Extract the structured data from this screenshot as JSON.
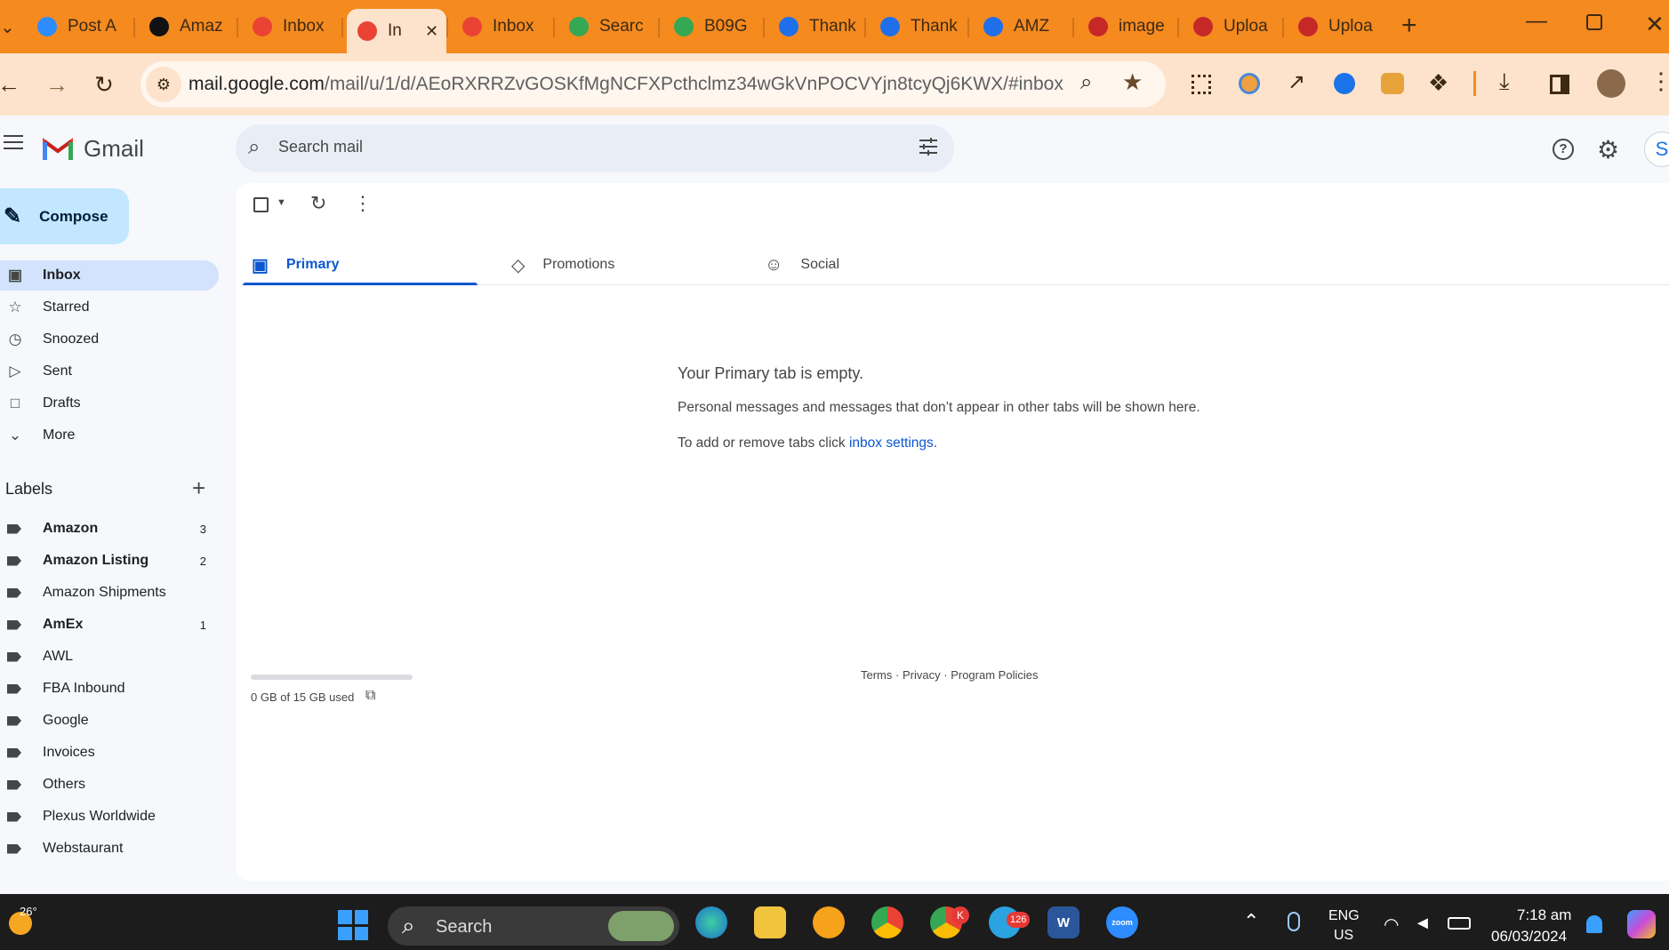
{
  "browser": {
    "tabs": [
      {
        "title": "Post A",
        "icon": "zoom-icon",
        "color": "#2d8cff"
      },
      {
        "title": "Amaz",
        "icon": "amazon-icon",
        "color": "#111111"
      },
      {
        "title": "Inbox",
        "icon": "gmail-icon",
        "color": "#ea4335"
      },
      {
        "title": "In",
        "icon": "gmail-icon",
        "color": "#ea4335",
        "active": true
      },
      {
        "title": "Inbox",
        "icon": "gmail-icon",
        "color": "#ea4335"
      },
      {
        "title": "Searc",
        "icon": "drive-icon",
        "color": "#34a853"
      },
      {
        "title": "B09G",
        "icon": "drive-icon",
        "color": "#34a853"
      },
      {
        "title": "Thank",
        "icon": "pen-icon",
        "color": "#1f6feb"
      },
      {
        "title": "Thank",
        "icon": "pen-icon",
        "color": "#1f6feb"
      },
      {
        "title": "AMZ",
        "icon": "pen-icon",
        "color": "#1f6feb"
      },
      {
        "title": "image",
        "icon": "shield-icon",
        "color": "#c62828"
      },
      {
        "title": "Uploa",
        "icon": "shield-icon",
        "color": "#c62828"
      },
      {
        "title": "Uploa",
        "icon": "shield-icon",
        "color": "#c62828"
      }
    ],
    "url_host": "mail.google.com",
    "url_path": "/mail/u/1/d/AEoRXRRZvGOSKfMgNCFXPcthclmz34wGkVnPOCVYjn8tcyQj6KWX/#inbox",
    "accent": "#f58a1f"
  },
  "gmail": {
    "brand": "Gmail",
    "search_placeholder": "Search mail",
    "avatar_letter": "S",
    "compose_label": "Compose",
    "nav": [
      {
        "label": "Inbox",
        "icon": "inbox-icon",
        "active": true
      },
      {
        "label": "Starred",
        "icon": "star-icon"
      },
      {
        "label": "Snoozed",
        "icon": "clock-icon"
      },
      {
        "label": "Sent",
        "icon": "send-icon"
      },
      {
        "label": "Drafts",
        "icon": "draft-icon"
      },
      {
        "label": "More",
        "icon": "chevron-down-icon"
      }
    ],
    "labels_heading": "Labels",
    "labels": [
      {
        "name": "Amazon",
        "count": "3",
        "bold": true
      },
      {
        "name": "Amazon Listing",
        "count": "2",
        "bold": true
      },
      {
        "name": "Amazon Shipments",
        "count": ""
      },
      {
        "name": "AmEx",
        "count": "1",
        "bold": true
      },
      {
        "name": "AWL",
        "count": ""
      },
      {
        "name": "FBA Inbound",
        "count": ""
      },
      {
        "name": "Google",
        "count": ""
      },
      {
        "name": "Invoices",
        "count": ""
      },
      {
        "name": "Others",
        "count": ""
      },
      {
        "name": "Plexus Worldwide",
        "count": ""
      },
      {
        "name": "Webstaurant",
        "count": ""
      }
    ],
    "tabs": [
      {
        "label": "Primary",
        "icon": "inbox-tab-icon"
      },
      {
        "label": "Promotions",
        "icon": "tag-icon"
      },
      {
        "label": "Social",
        "icon": "people-icon"
      }
    ],
    "empty": {
      "title": "Your Primary tab is empty.",
      "line1": "Personal messages and messages that don’t appear in other tabs will be shown here.",
      "line2_prefix": "To add or remove tabs click ",
      "line2_link": "inbox settings",
      "line2_suffix": "."
    },
    "storage": {
      "text": "0 GB of 15 GB used",
      "fraction": 0.0
    },
    "footer": {
      "terms": "Terms",
      "privacy": "Privacy",
      "policies": "Program Policies",
      "sep": "·"
    }
  },
  "taskbar": {
    "weather_temp": "26°",
    "search_label": "Search",
    "telegram_badge": "126",
    "chrome_badge": "K",
    "lang_top": "ENG",
    "lang_bottom": "US",
    "time": "7:18 am",
    "date": "06/03/2024",
    "zoom_label": "zoom",
    "word_label": "W"
  }
}
